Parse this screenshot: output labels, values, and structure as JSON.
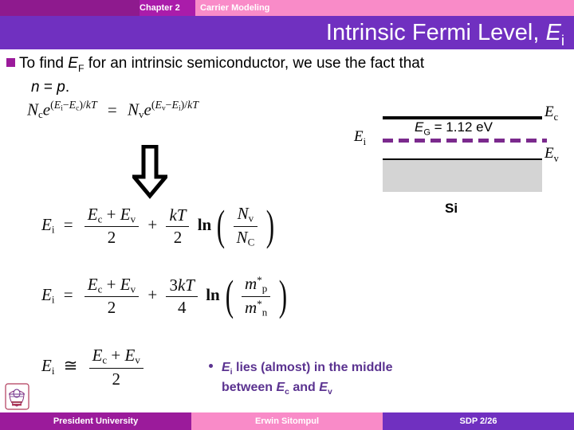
{
  "header": {
    "chapter": "Chapter 2",
    "topic": "Carrier Modeling",
    "title_main": "Intrinsic Fermi Level, ",
    "title_var": "E",
    "title_var_sub": "i"
  },
  "body": {
    "bullet_line1_a": "To find ",
    "bullet_line1_var": "E",
    "bullet_line1_var_sub": "F",
    "bullet_line1_b": " for an intrinsic semiconductor, we use the fact that",
    "bullet_line2_n": "n",
    "bullet_line2_eq": " = ",
    "bullet_line2_p": "p",
    "bullet_line2_end": "."
  },
  "equations": {
    "eq1": {
      "lhs_N": "N",
      "lhs_N_sub": "c",
      "lhs_e": "e",
      "lhs_exp_open": "(",
      "lhs_exp_E1": "E",
      "lhs_exp_E1_sub": "i",
      "lhs_exp_minus": "−",
      "lhs_exp_E2": "E",
      "lhs_exp_E2_sub": "c",
      "lhs_exp_close": ")/",
      "lhs_exp_kT": "kT",
      "equals": "=",
      "rhs_N": "N",
      "rhs_N_sub": "v",
      "rhs_e": "e",
      "rhs_exp_open": "(",
      "rhs_exp_E1": "E",
      "rhs_exp_E1_sub": "v",
      "rhs_exp_minus": "−",
      "rhs_exp_E2": "E",
      "rhs_exp_E2_sub": "i",
      "rhs_exp_close": ")/",
      "rhs_exp_kT": "kT"
    },
    "eq2": {
      "lhs": "E",
      "lhs_sub": "i",
      "rel": "=",
      "f1_num_Ec": "E",
      "f1_num_Ec_sub": "c",
      "f1_num_plus": " + ",
      "f1_num_Ev": "E",
      "f1_num_Ev_sub": "v",
      "f1_den": "2",
      "plus": "+",
      "f2_num": "kT",
      "f2_den": "2",
      "ln": "ln",
      "f3_num": "N",
      "f3_num_sub": "v",
      "f3_den": "N",
      "f3_den_sub": "C"
    },
    "eq3": {
      "lhs": "E",
      "lhs_sub": "i",
      "rel": "=",
      "f1_num_Ec": "E",
      "f1_num_Ec_sub": "c",
      "f1_num_plus": " + ",
      "f1_num_Ev": "E",
      "f1_num_Ev_sub": "v",
      "f1_den": "2",
      "plus": "+",
      "f2_num_3": "3",
      "f2_num_kT": "kT",
      "f2_den": "4",
      "ln": "ln",
      "f3_num_m": "m",
      "f3_num_star": "*",
      "f3_num_sub": "p",
      "f3_den_m": "m",
      "f3_den_star": "*",
      "f3_den_sub": "n"
    },
    "eq4": {
      "lhs": "E",
      "lhs_sub": "i",
      "rel": "≅",
      "f1_num_Ec": "E",
      "f1_num_Ec_sub": "c",
      "f1_num_plus": " + ",
      "f1_num_Ev": "E",
      "f1_num_Ev_sub": "v",
      "f1_den": "2"
    }
  },
  "band_diagram": {
    "label_ec": "E",
    "label_ec_sub": "c",
    "label_ev": "E",
    "label_ev_sub": "v",
    "label_ei": "E",
    "label_ei_sub": "i",
    "eg_var": "E",
    "eg_sub": "G",
    "eg_value": " = 1.12 eV",
    "material": "Si",
    "colors": {
      "ei_dash": "#7b2a8d",
      "band_fill": "#d4d4d4",
      "line": "#000000"
    }
  },
  "conclusion": {
    "var1": "E",
    "var1_sub": "i",
    "text1": " lies (almost) in the middle",
    "text2": "between ",
    "var2": "E",
    "var2_sub": "c",
    "text3": " and ",
    "var3": "E",
    "var3_sub": "v"
  },
  "footer": {
    "left": "President University",
    "center": "Erwin Sitompul",
    "right": "SDP 2/26"
  },
  "theme": {
    "chapter_bar": "#aa1caa",
    "chapter_bar_dark": "#8e1a8e",
    "topic_bar": "#f98bc8",
    "title_bar": "#7030c0",
    "bullet_square": "#9b1b9b",
    "conclusion_text": "#5b3390"
  }
}
